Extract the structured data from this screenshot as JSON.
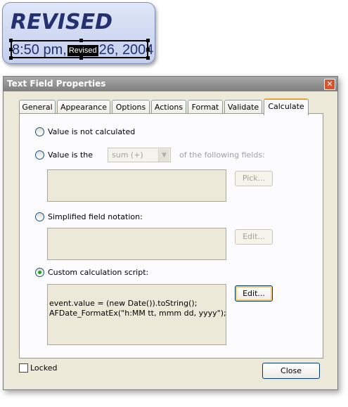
{
  "stamp": {
    "title": "REVISED",
    "date_left": "8:50 pm,",
    "date_tag": "Revised",
    "date_right": "26, 2004"
  },
  "dialog": {
    "title": "Text Field Properties",
    "close_glyph": "✕",
    "tabs": [
      "General",
      "Appearance",
      "Options",
      "Actions",
      "Format",
      "Validate",
      "Calculate"
    ],
    "active_tab": "Calculate",
    "options": {
      "not_calculated": "Value is not calculated",
      "value_is_the": "Value is the",
      "function_select": "sum (+)",
      "of_following_fields": "of the following fields:",
      "pick_button": "Pick...",
      "simplified": "Simplified field notation:",
      "simplified_edit_button": "Edit...",
      "custom_script": "Custom calculation script:",
      "custom_edit_button": "Edit...",
      "selected": "custom_script"
    },
    "script_lines": [
      "event.value = (new Date()).toString();",
      "AFDate_FormatEx(\"h:MM tt, mmm dd, yyyy\");"
    ],
    "locked_label": "Locked",
    "locked_checked": false,
    "close_button": "Close"
  }
}
